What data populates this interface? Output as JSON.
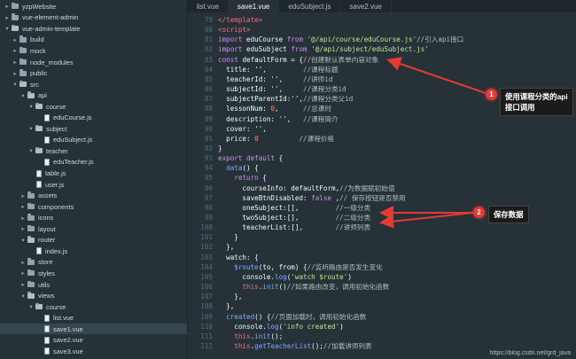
{
  "tabs": [
    {
      "label": "list.vue",
      "active": false
    },
    {
      "label": "save1.vue",
      "active": true
    },
    {
      "label": "eduSubject.js",
      "active": false
    },
    {
      "label": "save2.vue",
      "active": false
    }
  ],
  "file_tree": [
    {
      "label": "yzpWebsite",
      "kind": "folder",
      "depth": 0,
      "expanded": false
    },
    {
      "label": "vue-element-admin",
      "kind": "folder",
      "depth": 0,
      "expanded": false
    },
    {
      "label": "vue-admin-template",
      "kind": "folder",
      "depth": 0,
      "expanded": true
    },
    {
      "label": "build",
      "kind": "folder",
      "depth": 1,
      "expanded": false
    },
    {
      "label": "mock",
      "kind": "folder",
      "depth": 1,
      "expanded": false
    },
    {
      "label": "node_modules",
      "kind": "folder",
      "depth": 1,
      "expanded": false
    },
    {
      "label": "public",
      "kind": "folder",
      "depth": 1,
      "expanded": false
    },
    {
      "label": "src",
      "kind": "folder",
      "depth": 1,
      "expanded": true
    },
    {
      "label": "api",
      "kind": "folder",
      "depth": 2,
      "expanded": true
    },
    {
      "label": "course",
      "kind": "folder",
      "depth": 3,
      "expanded": true
    },
    {
      "label": "eduCourse.js",
      "kind": "file",
      "depth": 4
    },
    {
      "label": "subject",
      "kind": "folder",
      "depth": 3,
      "expanded": true
    },
    {
      "label": "eduSubject.js",
      "kind": "file",
      "depth": 4
    },
    {
      "label": "teacher",
      "kind": "folder",
      "depth": 3,
      "expanded": true
    },
    {
      "label": "eduTeacher.js",
      "kind": "file",
      "depth": 4
    },
    {
      "label": "table.js",
      "kind": "file",
      "depth": 3
    },
    {
      "label": "user.js",
      "kind": "file",
      "depth": 3
    },
    {
      "label": "assets",
      "kind": "folder",
      "depth": 2,
      "expanded": false
    },
    {
      "label": "components",
      "kind": "folder",
      "depth": 2,
      "expanded": false
    },
    {
      "label": "icons",
      "kind": "folder",
      "depth": 2,
      "expanded": false
    },
    {
      "label": "layout",
      "kind": "folder",
      "depth": 2,
      "expanded": false
    },
    {
      "label": "router",
      "kind": "folder",
      "depth": 2,
      "expanded": true
    },
    {
      "label": "index.js",
      "kind": "file",
      "depth": 3
    },
    {
      "label": "store",
      "kind": "folder",
      "depth": 2,
      "expanded": false
    },
    {
      "label": "styles",
      "kind": "folder",
      "depth": 2,
      "expanded": false
    },
    {
      "label": "utils",
      "kind": "folder",
      "depth": 2,
      "expanded": false
    },
    {
      "label": "views",
      "kind": "folder",
      "depth": 2,
      "expanded": true
    },
    {
      "label": "course",
      "kind": "folder",
      "depth": 3,
      "expanded": true
    },
    {
      "label": "list.vue",
      "kind": "file",
      "depth": 4
    },
    {
      "label": "save1.vue",
      "kind": "file",
      "depth": 4,
      "selected": true
    },
    {
      "label": "save2.vue",
      "kind": "file",
      "depth": 4
    },
    {
      "label": "save3.vue",
      "kind": "file",
      "depth": 4
    }
  ],
  "code_lines": [
    {
      "n": "79",
      "tokens": [
        {
          "t": "</template>",
          "c": "tag"
        }
      ]
    },
    {
      "n": "80",
      "tokens": [
        {
          "t": "<script>",
          "c": "tag"
        }
      ]
    },
    {
      "n": "81",
      "tokens": [
        {
          "t": "import ",
          "c": "keyword"
        },
        {
          "t": "eduCourse ",
          "c": "default"
        },
        {
          "t": "from ",
          "c": "keyword"
        },
        {
          "t": "'@/api/course/eduCourse.js'",
          "c": "string"
        },
        {
          "t": "//引入api接口",
          "c": "comment"
        }
      ]
    },
    {
      "n": "82",
      "tokens": [
        {
          "t": "import ",
          "c": "keyword"
        },
        {
          "t": "eduSubject ",
          "c": "default"
        },
        {
          "t": "from ",
          "c": "keyword"
        },
        {
          "t": "'@/api/subject/eduSubject.js'",
          "c": "string"
        }
      ]
    },
    {
      "n": "83",
      "tokens": [
        {
          "t": "const ",
          "c": "keyword"
        },
        {
          "t": "defaultForm = {",
          "c": "default"
        },
        {
          "t": "//创建默认表单内容对象",
          "c": "comment"
        }
      ]
    },
    {
      "n": "84",
      "tokens": [
        {
          "t": "  title: '',         ",
          "c": "default"
        },
        {
          "t": "//课程标题",
          "c": "comment"
        }
      ]
    },
    {
      "n": "85",
      "tokens": [
        {
          "t": "  teacherId: '',     ",
          "c": "default"
        },
        {
          "t": "//讲师id",
          "c": "comment"
        }
      ]
    },
    {
      "n": "86",
      "tokens": [
        {
          "t": "  subjectId: '',     ",
          "c": "default"
        },
        {
          "t": "//课程分类id",
          "c": "comment"
        }
      ]
    },
    {
      "n": "87",
      "tokens": [
        {
          "t": "  subjectParentId:'',",
          "c": "default"
        },
        {
          "t": "//课程分类父id",
          "c": "comment"
        }
      ]
    },
    {
      "n": "88",
      "tokens": [
        {
          "t": "  lessonNum: ",
          "c": "default"
        },
        {
          "t": "0",
          "c": "number"
        },
        {
          "t": ",      ",
          "c": "default"
        },
        {
          "t": "//总课时",
          "c": "comment"
        }
      ]
    },
    {
      "n": "89",
      "tokens": [
        {
          "t": "  description: '',   ",
          "c": "default"
        },
        {
          "t": "//课程简介",
          "c": "comment"
        }
      ]
    },
    {
      "n": "90",
      "tokens": [
        {
          "t": "  cover: '',",
          "c": "default"
        }
      ]
    },
    {
      "n": "91",
      "tokens": [
        {
          "t": "  price: ",
          "c": "default"
        },
        {
          "t": "0",
          "c": "number"
        },
        {
          "t": "          ",
          "c": "default"
        },
        {
          "t": "//课程价格",
          "c": "comment"
        }
      ]
    },
    {
      "n": "92",
      "tokens": [
        {
          "t": "}",
          "c": "default"
        }
      ]
    },
    {
      "n": "93",
      "tokens": [
        {
          "t": "export default ",
          "c": "keyword"
        },
        {
          "t": "{",
          "c": "default"
        }
      ]
    },
    {
      "n": "94",
      "tokens": [
        {
          "t": "  data",
          "c": "func"
        },
        {
          "t": "() {",
          "c": "default"
        }
      ]
    },
    {
      "n": "95",
      "tokens": [
        {
          "t": "    return ",
          "c": "keyword"
        },
        {
          "t": "{",
          "c": "default"
        }
      ]
    },
    {
      "n": "96",
      "tokens": [
        {
          "t": "      courseInfo: defaultForm,",
          "c": "default"
        },
        {
          "t": "//为数据赋初始值",
          "c": "comment"
        }
      ]
    },
    {
      "n": "97",
      "tokens": [
        {
          "t": "      saveBtnDisabled: ",
          "c": "default"
        },
        {
          "t": "false ",
          "c": "keyword"
        },
        {
          "t": ",",
          "c": "default"
        },
        {
          "t": "// 保存按钮是否禁用",
          "c": "comment"
        }
      ]
    },
    {
      "n": "98",
      "tokens": [
        {
          "t": "      oneSubject:[],         ",
          "c": "default"
        },
        {
          "t": "//一级分类",
          "c": "comment"
        }
      ]
    },
    {
      "n": "99",
      "tokens": [
        {
          "t": "      twoSubject:[],         ",
          "c": "default"
        },
        {
          "t": "//二级分类",
          "c": "comment"
        }
      ]
    },
    {
      "n": "100",
      "tokens": [
        {
          "t": "      teacherList:[],        ",
          "c": "default"
        },
        {
          "t": "//讲师列表",
          "c": "comment"
        }
      ]
    },
    {
      "n": "101",
      "tokens": [
        {
          "t": "    }",
          "c": "default"
        }
      ]
    },
    {
      "n": "102",
      "tokens": [
        {
          "t": "  },",
          "c": "default"
        }
      ]
    },
    {
      "n": "103",
      "tokens": [
        {
          "t": "  watch: {",
          "c": "default"
        }
      ]
    },
    {
      "n": "104",
      "tokens": [
        {
          "t": "    $route",
          "c": "func"
        },
        {
          "t": "(to, from) {",
          "c": "default"
        },
        {
          "t": "//监听路由是否发生变化",
          "c": "comment"
        }
      ]
    },
    {
      "n": "105",
      "tokens": [
        {
          "t": "      console.",
          "c": "default"
        },
        {
          "t": "log",
          "c": "func"
        },
        {
          "t": "(",
          "c": "default"
        },
        {
          "t": "'watch $route'",
          "c": "string"
        },
        {
          "t": ")",
          "c": "default"
        }
      ]
    },
    {
      "n": "106",
      "tokens": [
        {
          "t": "      this",
          "c": "this"
        },
        {
          "t": ".",
          "c": "default"
        },
        {
          "t": "init",
          "c": "func"
        },
        {
          "t": "()",
          "c": "default"
        },
        {
          "t": "//如果路由改变，调用初始化函数",
          "c": "comment"
        }
      ]
    },
    {
      "n": "107",
      "tokens": [
        {
          "t": "    },",
          "c": "default"
        }
      ]
    },
    {
      "n": "108",
      "tokens": [
        {
          "t": "  },",
          "c": "default"
        }
      ]
    },
    {
      "n": "109",
      "tokens": [
        {
          "t": "  created",
          "c": "func"
        },
        {
          "t": "() {",
          "c": "default"
        },
        {
          "t": "//页面加载时，调用初始化函数",
          "c": "comment"
        }
      ]
    },
    {
      "n": "110",
      "tokens": [
        {
          "t": "    console.",
          "c": "default"
        },
        {
          "t": "log",
          "c": "func"
        },
        {
          "t": "(",
          "c": "default"
        },
        {
          "t": "'info created'",
          "c": "string"
        },
        {
          "t": ")",
          "c": "default"
        }
      ]
    },
    {
      "n": "111",
      "tokens": [
        {
          "t": "    this",
          "c": "this"
        },
        {
          "t": ".",
          "c": "default"
        },
        {
          "t": "init",
          "c": "func"
        },
        {
          "t": "();",
          "c": "default"
        }
      ]
    },
    {
      "n": "112",
      "tokens": [
        {
          "t": "    this",
          "c": "this"
        },
        {
          "t": ".",
          "c": "default"
        },
        {
          "t": "getTeacherList",
          "c": "func"
        },
        {
          "t": "();",
          "c": "default"
        },
        {
          "t": "//加载讲师列表",
          "c": "comment"
        }
      ]
    }
  ],
  "annotations": [
    {
      "number": "1",
      "text": "使用课程分类的api\n接口调用"
    },
    {
      "number": "2",
      "text": "保存数据"
    }
  ],
  "watermark": "https://blog.csdn.net/grd_java",
  "colors": {
    "editor_bg": "#263238",
    "annotation_red": "#e53935",
    "callout_bg": "#1b1b1b"
  }
}
